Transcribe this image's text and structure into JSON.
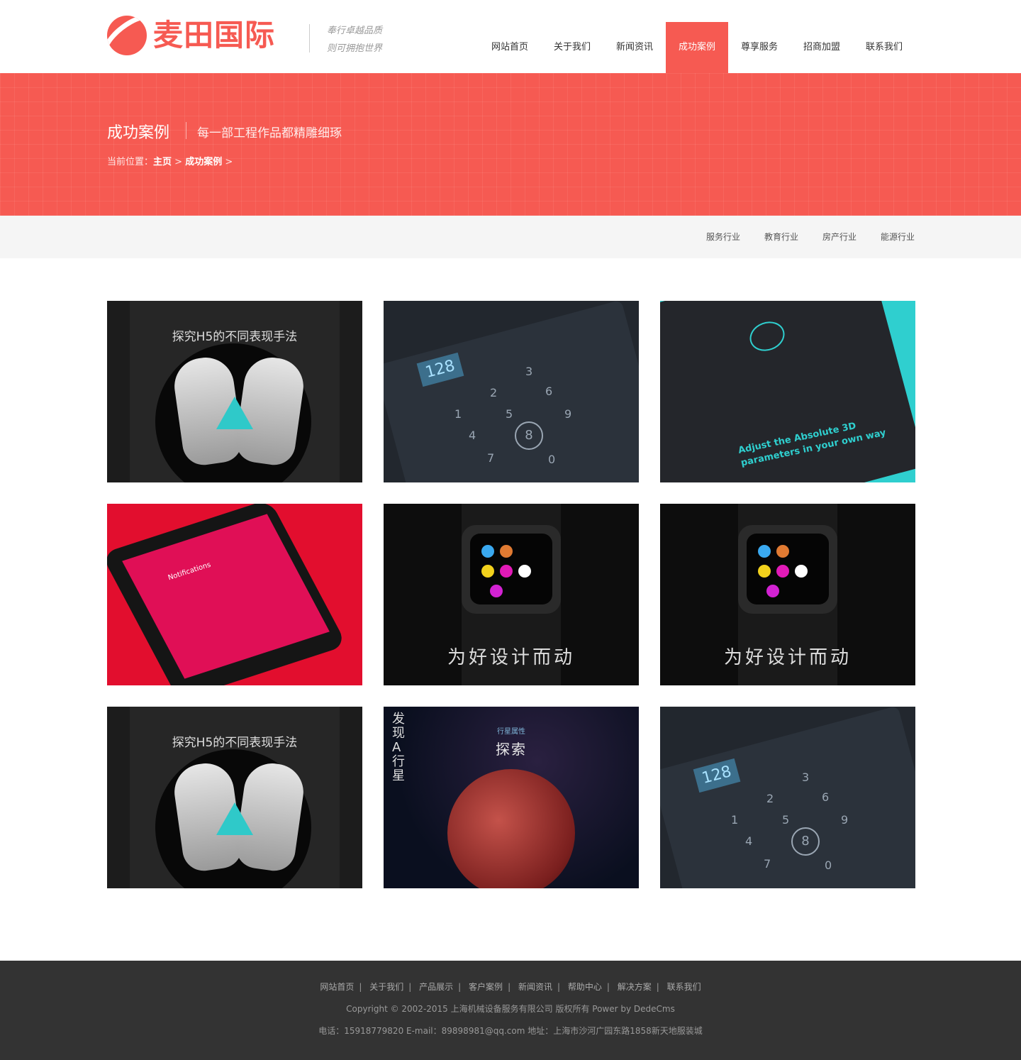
{
  "header": {
    "logo_text": "麦田国际",
    "slogan_line1": "奉行卓越品质",
    "slogan_line2": "则可拥抱世界",
    "nav": [
      {
        "label": "网站首页"
      },
      {
        "label": "关于我们"
      },
      {
        "label": "新闻资讯"
      },
      {
        "label": "成功案例",
        "active": true
      },
      {
        "label": "尊享服务"
      },
      {
        "label": "招商加盟"
      },
      {
        "label": "联系我们"
      }
    ]
  },
  "banner": {
    "title": "成功案例",
    "subtitle": "每一部工程作品都精雕细琢",
    "crumb_prefix": "当前位置：",
    "crumb_home": "主页",
    "crumb_sep": ">",
    "crumb_current": "成功案例"
  },
  "filters": [
    "服务行业",
    "教育行业",
    "房产行业",
    "能源行业"
  ],
  "cases": [
    {
      "type": "hands",
      "title": "探究H5的不同表现手法"
    },
    {
      "type": "keypad",
      "amount": "128",
      "keys": [
        "1",
        "2",
        "3",
        "4",
        "5",
        "6",
        "7",
        "8",
        "9",
        "0"
      ]
    },
    {
      "type": "absolute",
      "caption": "Adjust the Absolute 3D parameters in your own way"
    },
    {
      "type": "notify",
      "label": "Notifications"
    },
    {
      "type": "watch",
      "caption": "为好设计而动"
    },
    {
      "type": "watch",
      "caption": "为好设计而动"
    },
    {
      "type": "hands",
      "title": "探究H5的不同表现手法"
    },
    {
      "type": "planet",
      "vertical": "发现A行星",
      "small": "行星属性",
      "big": "探索"
    },
    {
      "type": "keypad",
      "amount": "128",
      "keys": [
        "1",
        "2",
        "3",
        "4",
        "5",
        "6",
        "7",
        "8",
        "9",
        "0"
      ]
    }
  ],
  "footer": {
    "links": [
      "网站首页",
      "关于我们",
      "产品展示",
      "客户案例",
      "新闻资讯",
      "帮助中心",
      "解决方案",
      "联系我们"
    ],
    "copyright": "Copyright © 2002-2015 上海机械设备服务有限公司 版权所有 Power by DedeCms",
    "contact": "电话：15918779820 E-mail：89898981@qq.com 地址：上海市沙河广园东路1858新天地服装城"
  },
  "colors": {
    "accent": "#f65a52",
    "footer_bg": "#333333",
    "filter_bg": "#f5f5f5"
  }
}
